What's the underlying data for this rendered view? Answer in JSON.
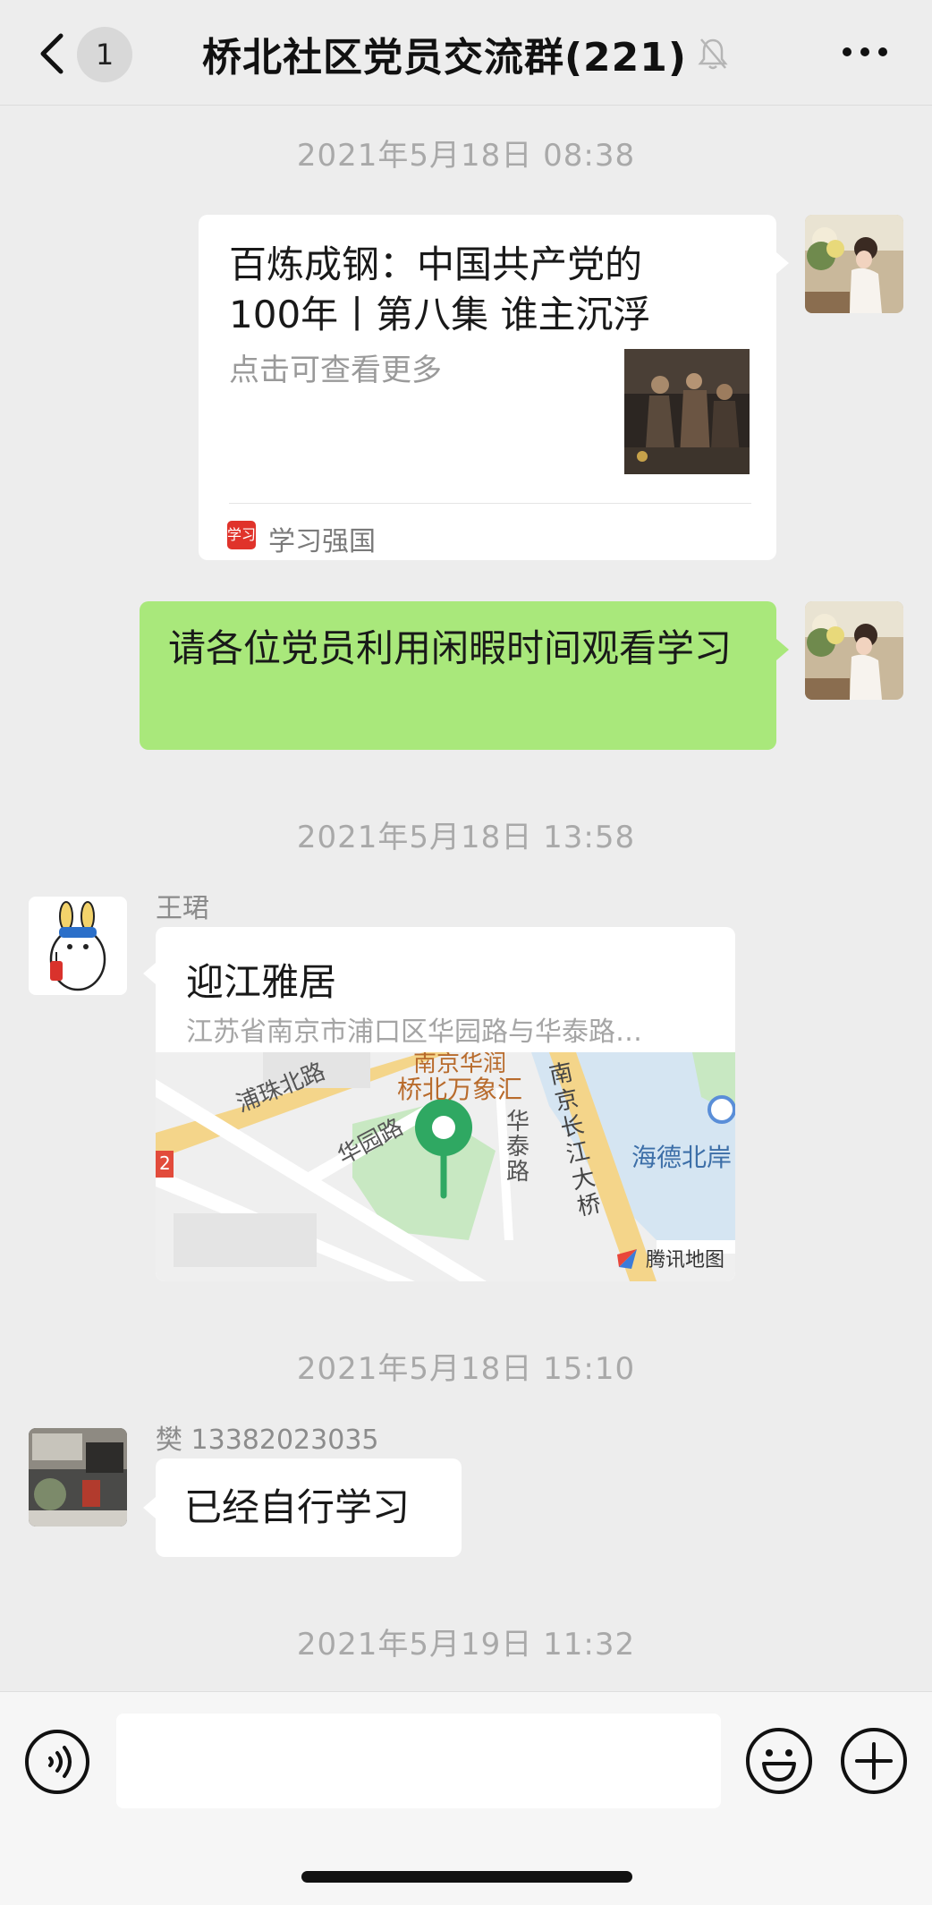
{
  "header": {
    "unread_count": "1",
    "title": "桥北社区党员交流群(221)"
  },
  "timestamps": [
    "2021年5月18日 08:38",
    "2021年5月18日 13:58",
    "2021年5月18日 15:10",
    "2021年5月19日 11:32"
  ],
  "messages": {
    "article": {
      "title": "百炼成钢：中国共产党的100年丨第八集 谁主沉浮",
      "description": "点击可查看更多",
      "source": "学习强国",
      "source_icon_text": "学习"
    },
    "text_self": "请各位党员利用闲暇时间观看学习",
    "location": {
      "sender": "王珺",
      "name": "迎江雅居",
      "address": "江苏省南京市浦口区华园路与华泰路…",
      "map_labels": {
        "poi_top": "南京华润",
        "poi_main": "桥北万象汇",
        "road_pujiang": "浦珠北路",
        "road_huayuan": "华园路",
        "road_huatai": "华泰路",
        "bridge": "南京长江大桥",
        "area": "海德北岸",
        "marker_2": "2"
      },
      "map_brand": "腾讯地图"
    },
    "text_other": {
      "sender": "樊 13382023035",
      "text": "已经自行学习"
    }
  },
  "input": {
    "placeholder": ""
  },
  "icons": {
    "back": "chevron-left-icon",
    "mute": "bell-muted-icon",
    "more": "more-dots-icon",
    "voice": "voice-icon",
    "emoji": "emoji-icon",
    "plus": "plus-icon"
  },
  "colors": {
    "background": "#ededed",
    "self_bubble": "#a9e87b",
    "other_bubble": "#ffffff",
    "timestamp": "#a9a9a9"
  }
}
